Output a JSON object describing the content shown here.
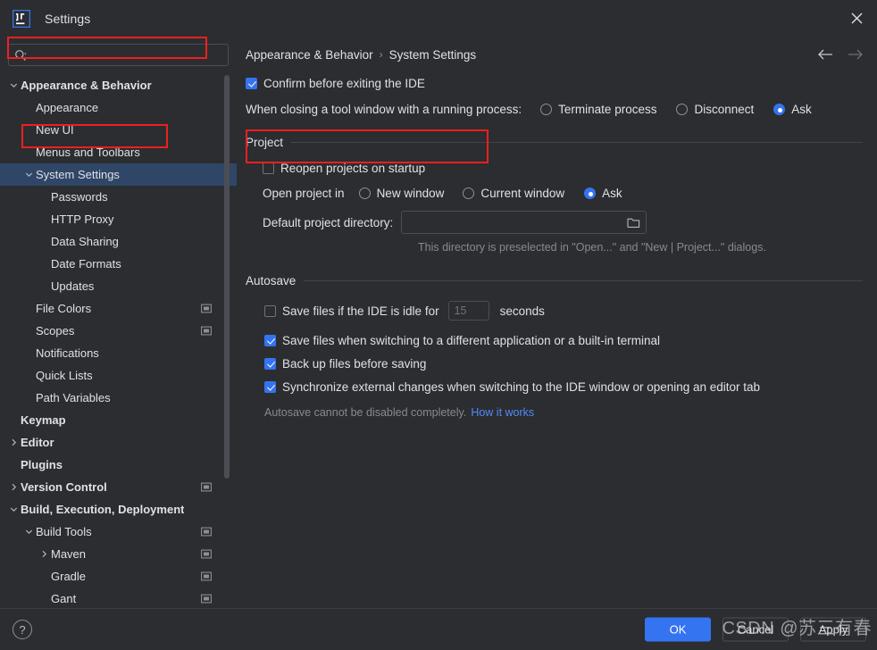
{
  "window": {
    "title": "Settings",
    "app_icon": "intellij-idea-logo",
    "close_icon": "close-icon"
  },
  "search": {
    "value": "",
    "placeholder": "",
    "icon": "search-icon"
  },
  "sidebar": {
    "items": [
      {
        "label": "Appearance & Behavior",
        "indent": 0,
        "arrow": "chevron-down",
        "bold": true,
        "selected": false,
        "cfg_icon": false,
        "annotated": true
      },
      {
        "label": "Appearance",
        "indent": 1,
        "arrow": "none",
        "bold": false,
        "selected": false,
        "cfg_icon": false
      },
      {
        "label": "New UI",
        "indent": 1,
        "arrow": "none",
        "bold": false,
        "selected": false,
        "cfg_icon": false
      },
      {
        "label": "Menus and Toolbars",
        "indent": 1,
        "arrow": "none",
        "bold": false,
        "selected": false,
        "cfg_icon": false
      },
      {
        "label": "System Settings",
        "indent": 1,
        "arrow": "chevron-down",
        "bold": false,
        "selected": true,
        "cfg_icon": false,
        "annotated": true
      },
      {
        "label": "Passwords",
        "indent": 2,
        "arrow": "none",
        "bold": false,
        "selected": false,
        "cfg_icon": false
      },
      {
        "label": "HTTP Proxy",
        "indent": 2,
        "arrow": "none",
        "bold": false,
        "selected": false,
        "cfg_icon": false
      },
      {
        "label": "Data Sharing",
        "indent": 2,
        "arrow": "none",
        "bold": false,
        "selected": false,
        "cfg_icon": false
      },
      {
        "label": "Date Formats",
        "indent": 2,
        "arrow": "none",
        "bold": false,
        "selected": false,
        "cfg_icon": false
      },
      {
        "label": "Updates",
        "indent": 2,
        "arrow": "none",
        "bold": false,
        "selected": false,
        "cfg_icon": false
      },
      {
        "label": "File Colors",
        "indent": 1,
        "arrow": "none",
        "bold": false,
        "selected": false,
        "cfg_icon": true
      },
      {
        "label": "Scopes",
        "indent": 1,
        "arrow": "none",
        "bold": false,
        "selected": false,
        "cfg_icon": true
      },
      {
        "label": "Notifications",
        "indent": 1,
        "arrow": "none",
        "bold": false,
        "selected": false,
        "cfg_icon": false
      },
      {
        "label": "Quick Lists",
        "indent": 1,
        "arrow": "none",
        "bold": false,
        "selected": false,
        "cfg_icon": false
      },
      {
        "label": "Path Variables",
        "indent": 1,
        "arrow": "none",
        "bold": false,
        "selected": false,
        "cfg_icon": false
      },
      {
        "label": "Keymap",
        "indent": 0,
        "arrow": "none",
        "bold": true,
        "selected": false,
        "cfg_icon": false
      },
      {
        "label": "Editor",
        "indent": 0,
        "arrow": "chevron-right",
        "bold": true,
        "selected": false,
        "cfg_icon": false
      },
      {
        "label": "Plugins",
        "indent": 0,
        "arrow": "none",
        "bold": true,
        "selected": false,
        "cfg_icon": false
      },
      {
        "label": "Version Control",
        "indent": 0,
        "arrow": "chevron-right",
        "bold": true,
        "selected": false,
        "cfg_icon": true
      },
      {
        "label": "Build, Execution, Deployment",
        "indent": 0,
        "arrow": "chevron-down",
        "bold": true,
        "selected": false,
        "cfg_icon": false
      },
      {
        "label": "Build Tools",
        "indent": 1,
        "arrow": "chevron-down",
        "bold": false,
        "selected": false,
        "cfg_icon": true
      },
      {
        "label": "Maven",
        "indent": 2,
        "arrow": "chevron-right",
        "bold": false,
        "selected": false,
        "cfg_icon": true
      },
      {
        "label": "Gradle",
        "indent": 2,
        "arrow": "none",
        "bold": false,
        "selected": false,
        "cfg_icon": true
      },
      {
        "label": "Gant",
        "indent": 2,
        "arrow": "none",
        "bold": false,
        "selected": false,
        "cfg_icon": true
      }
    ]
  },
  "breadcrumb": {
    "parent": "Appearance & Behavior",
    "separator": "›",
    "current": "System Settings",
    "back_icon": "arrow-left-icon",
    "forward_icon": "arrow-right-icon"
  },
  "main": {
    "confirm_exit": {
      "label": "Confirm before exiting the IDE",
      "checked": true
    },
    "closing_tool_window": {
      "label": "When closing a tool window with a running process:",
      "options": [
        {
          "label": "Terminate process",
          "selected": false
        },
        {
          "label": "Disconnect",
          "selected": false
        },
        {
          "label": "Ask",
          "selected": true
        }
      ]
    },
    "project": {
      "group_title": "Project",
      "reopen": {
        "label": "Reopen projects on startup",
        "checked": false
      },
      "open_project_in": {
        "label": "Open project in",
        "options": [
          {
            "label": "New window",
            "selected": false
          },
          {
            "label": "Current window",
            "selected": false
          },
          {
            "label": "Ask",
            "selected": true
          }
        ]
      },
      "default_dir": {
        "label": "Default project directory:",
        "value": "",
        "placeholder": "",
        "browse_icon": "folder-icon",
        "hint": "This directory is preselected in \"Open...\" and \"New | Project...\" dialogs."
      }
    },
    "autosave": {
      "group_title": "Autosave",
      "idle": {
        "label_before": "Save files if the IDE is idle for",
        "value": "15",
        "label_after": "seconds",
        "checked": false
      },
      "items": [
        {
          "label": "Save files when switching to a different application or a built-in terminal",
          "checked": true
        },
        {
          "label": "Back up files before saving",
          "checked": true
        },
        {
          "label": "Synchronize external changes when switching to the IDE window or opening an editor tab",
          "checked": true
        }
      ],
      "note": "Autosave cannot be disabled completely.",
      "note_link": "How it works"
    }
  },
  "footer": {
    "help_icon": "help-question-icon",
    "ok_label": "OK",
    "cancel_label": "Cancel",
    "apply_label": "Apply"
  },
  "watermark": {
    "text": "CSDN @苏三有春"
  },
  "colors": {
    "background": "#2b2d30",
    "accent": "#3574f0",
    "selection": "#2f4667",
    "annotation": "#f01f1f",
    "link": "#548af7",
    "muted_text": "#868a91"
  }
}
